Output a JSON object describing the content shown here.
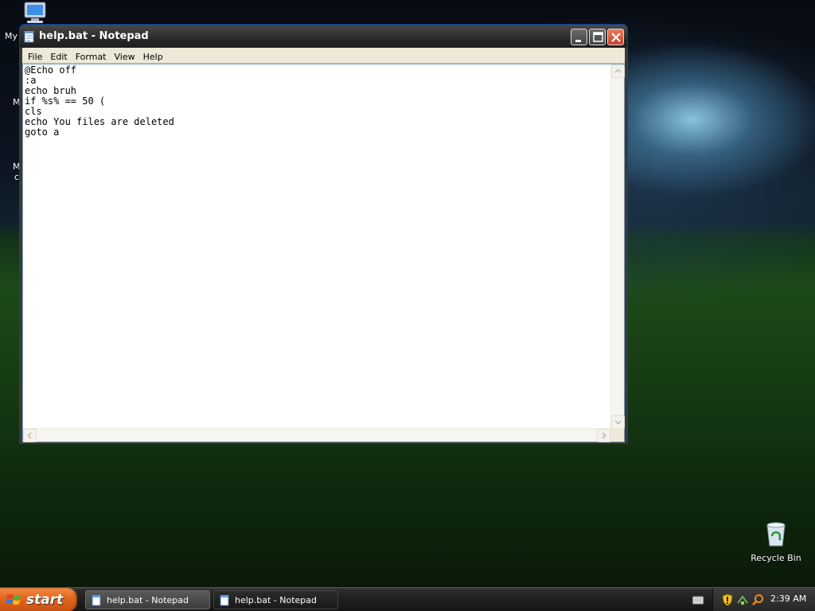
{
  "desktop": {
    "icons": {
      "my_computer": "My",
      "partial_1": "M",
      "partial_2": "M",
      "partial_3": "c",
      "recycle_bin": "Recycle Bin"
    }
  },
  "window": {
    "title": "help.bat - Notepad",
    "menu": [
      "File",
      "Edit",
      "Format",
      "View",
      "Help"
    ],
    "content": "@Echo off\n:a\necho bruh\nif %s% == 50 (\ncls\necho You files are deleted\ngoto a"
  },
  "taskbar": {
    "start_label": "start",
    "tasks": [
      {
        "label": "help.bat - Notepad",
        "active": false
      },
      {
        "label": "help.bat - Notepad",
        "active": true
      }
    ],
    "clock": "2:39 AM"
  },
  "colors": {
    "titlebar": "#2a2a2a",
    "start": "#e46a1e",
    "close": "#c9422a"
  }
}
